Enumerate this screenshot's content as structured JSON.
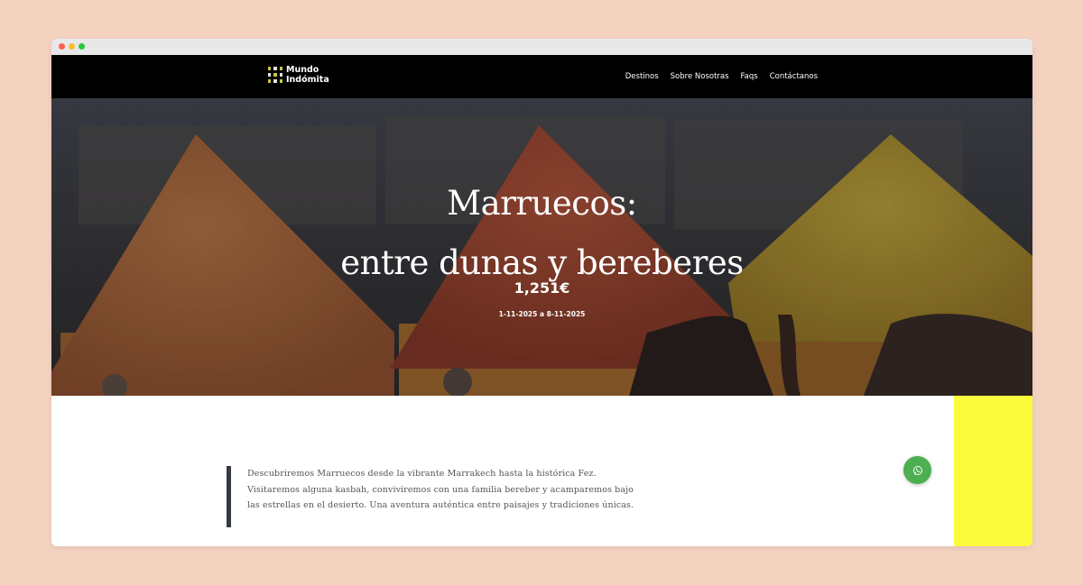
{
  "header": {
    "logo_line1": "Mundo",
    "logo_line2": "Indómita",
    "nav": [
      "Destinos",
      "Sobre Nosotras",
      "Faqs",
      "Contáctanos"
    ]
  },
  "hero": {
    "title_line1": "Marruecos:",
    "title_line2": "entre dunas y bereberes",
    "price": "1,251€",
    "dates": "1-11-2025 a 8-11-2025"
  },
  "content": {
    "description": "Descubriremos Marruecos desde la vibrante Marrakech hasta la histórica Fez. Visitaremos alguna kasbah, conviviremos con una familia bereber y acamparemos bajo las estrellas en el desierto. Una aventura auténtica entre paisajes y tradiciones únicas."
  },
  "floating": {
    "whatsapp_icon": "whatsapp-icon"
  },
  "colors": {
    "page_background": "#f4d2c0",
    "header_background": "#000000",
    "accent_yellow": "#fbfa3c",
    "quote_border": "#333a42",
    "whatsapp_green": "#4caf50"
  }
}
